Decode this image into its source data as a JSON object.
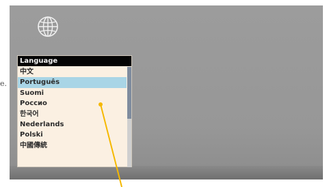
{
  "edge_text": "e.",
  "language_panel": {
    "title": "Language",
    "items": [
      {
        "label": "中文",
        "selected": false
      },
      {
        "label": "Português",
        "selected": true
      },
      {
        "label": "Suomi",
        "selected": false
      },
      {
        "label": "Россио",
        "selected": false
      },
      {
        "label": "한국어",
        "selected": false
      },
      {
        "label": "Nederlands",
        "selected": false
      },
      {
        "label": "Polski",
        "selected": false
      },
      {
        "label": "中國傳統",
        "selected": false
      }
    ]
  },
  "icons": {
    "language": "globe-icon"
  },
  "colors": {
    "screen_background": "#989898",
    "panel_background": "#fbf0e2",
    "title_bar": "#050505",
    "selection": "#a9d5e6",
    "pointer": "#f5b800"
  }
}
